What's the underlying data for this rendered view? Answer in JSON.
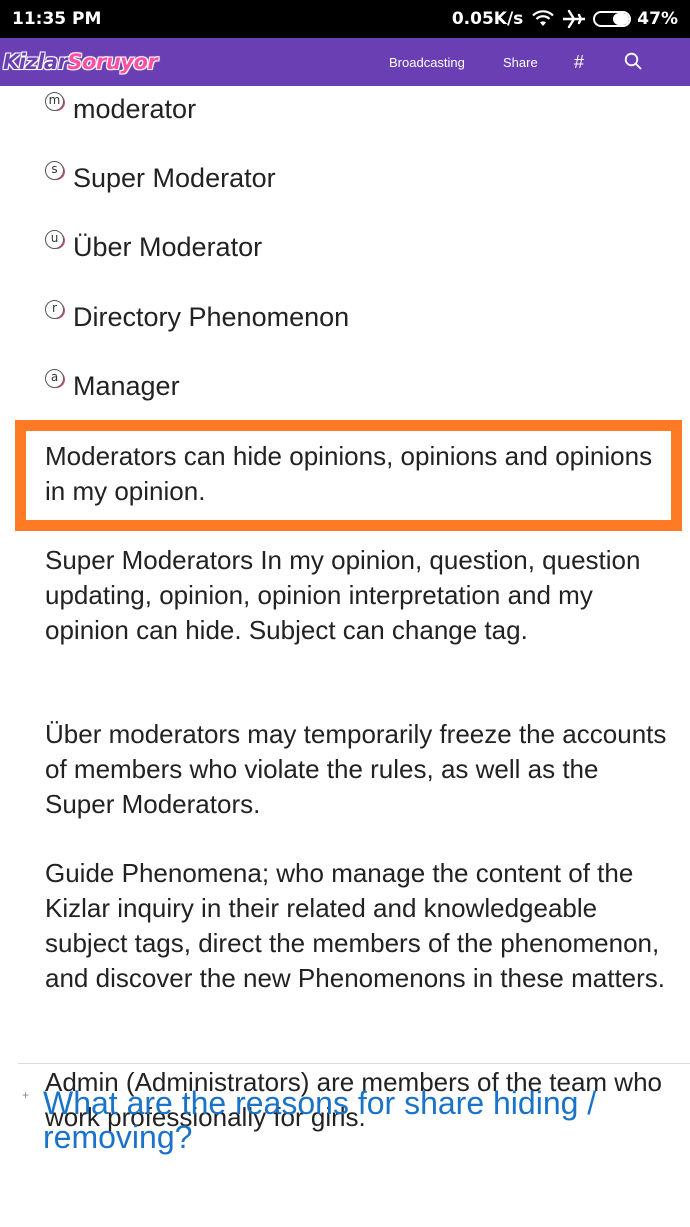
{
  "status_bar": {
    "time": "11:35 PM",
    "network_speed": "0.05K/s",
    "wifi_icon": "wifi-icon",
    "airplane_icon": "airplane-icon",
    "battery_percent": "47%",
    "battery_level": 0.47
  },
  "app_bar": {
    "logo_part1": "Kizlar",
    "logo_part2": "Soruyor",
    "broadcasting": "Broadcasting",
    "share": "Share",
    "hashtag": "#",
    "search_icon": "search-icon",
    "background": "#6a3fb4"
  },
  "roles": [
    {
      "icon": "m",
      "label": "moderator"
    },
    {
      "icon": "s",
      "label": "Super Moderator"
    },
    {
      "icon": "u",
      "label": "Über Moderator"
    },
    {
      "icon": "r",
      "label": "Directory Phenomenon"
    },
    {
      "icon": "a",
      "label": "Manager"
    }
  ],
  "paragraphs": {
    "moderators": "Moderators can hide opinions, opinions and opinions in my opinion.",
    "super_moderators": "Super Moderators In my opinion, question, question updating, opinion, opinion interpretation and my opinion can hide. Subject can change tag.",
    "uber_moderators": "Über moderators may temporarily freeze the accounts of members who violate the rules, as well as the Super Moderators.",
    "guide_phenomena": "Guide Phenomena; who manage the content of the Kizlar inquiry in their related and knowledgeable subject tags, direct the members of the phenomenon, and discover the new Phenomenons in these matters.",
    "admin": "Admin (Administrators) are members of the team who work professionally for girls."
  },
  "highlight_color": "#ff7a25",
  "faq": {
    "expand_symbol": "+",
    "title": "What are the reasons for share hiding / removing?",
    "color": "#1a73c9"
  }
}
